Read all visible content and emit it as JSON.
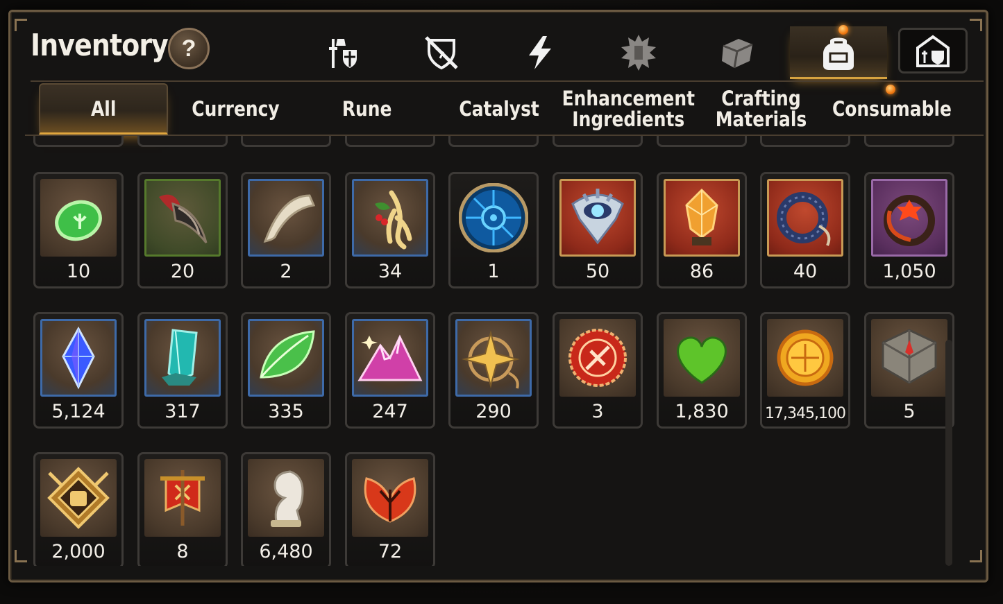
{
  "header": {
    "title": "Inventory",
    "help_label": "?"
  },
  "category_tabs": [
    {
      "name": "hero-gear-tab",
      "icon": "knight-shield-icon"
    },
    {
      "name": "artifact-tab",
      "icon": "crossed-shield-icon"
    },
    {
      "name": "energy-tab",
      "icon": "lightning-icon"
    },
    {
      "name": "skill-tab",
      "icon": "spiky-emblem-icon"
    },
    {
      "name": "material-tab",
      "icon": "cube-icon"
    },
    {
      "name": "bag-tab",
      "icon": "backpack-icon",
      "active": true
    },
    {
      "name": "guild-tab",
      "icon": "castle-icon"
    }
  ],
  "sub_tabs": [
    {
      "label": "All",
      "active": true
    },
    {
      "label": "Currency"
    },
    {
      "label": "Rune"
    },
    {
      "label": "Catalyst"
    },
    {
      "label": "Enhancement\nIngredients"
    },
    {
      "label": "Crafting\nMaterials"
    },
    {
      "label": "Consumable"
    }
  ],
  "items": [
    {
      "icon": "green-rune-stone-icon",
      "qty": "10",
      "frame": "brown"
    },
    {
      "icon": "claw-icon",
      "qty": "20",
      "frame": "green"
    },
    {
      "icon": "fang-icon",
      "qty": "2",
      "frame": "blue"
    },
    {
      "icon": "ginseng-root-icon",
      "qty": "34",
      "frame": "blue"
    },
    {
      "icon": "blue-rune-orb-icon",
      "qty": "1",
      "frame": "round"
    },
    {
      "icon": "eye-crest-icon",
      "qty": "50",
      "frame": "red"
    },
    {
      "icon": "fire-crystal-icon",
      "qty": "86",
      "frame": "red"
    },
    {
      "icon": "coiled-rope-icon",
      "qty": "40",
      "frame": "red"
    },
    {
      "icon": "flower-ring-icon",
      "qty": "1,050",
      "frame": "purple"
    },
    {
      "icon": "blue-gem-icon",
      "qty": "5,124",
      "frame": "blue"
    },
    {
      "icon": "cyan-crystal-icon",
      "qty": "317",
      "frame": "blue"
    },
    {
      "icon": "green-leaf-icon",
      "qty": "335",
      "frame": "blue"
    },
    {
      "icon": "pink-mountain-icon",
      "qty": "247",
      "frame": "blue"
    },
    {
      "icon": "compass-star-icon",
      "qty": "290",
      "frame": "blue"
    },
    {
      "icon": "red-seal-icon",
      "qty": "3",
      "frame": "brown"
    },
    {
      "icon": "green-heart-icon",
      "qty": "1,830",
      "frame": "brown"
    },
    {
      "icon": "gold-coin-icon",
      "qty": "17,345,100",
      "frame": "brown"
    },
    {
      "icon": "stone-compass-icon",
      "qty": "5",
      "frame": "brown"
    },
    {
      "icon": "fist-emblem-icon",
      "qty": "2,000",
      "frame": "brown"
    },
    {
      "icon": "banner-icon",
      "qty": "8",
      "frame": "brown"
    },
    {
      "icon": "knight-piece-icon",
      "qty": "6,480",
      "frame": "brown"
    },
    {
      "icon": "red-leaf-icon",
      "qty": "72",
      "frame": "brown"
    }
  ],
  "colors": {
    "accent": "#e0a63e",
    "notification": "#f07a12",
    "panel_border": "#6b5a42"
  }
}
